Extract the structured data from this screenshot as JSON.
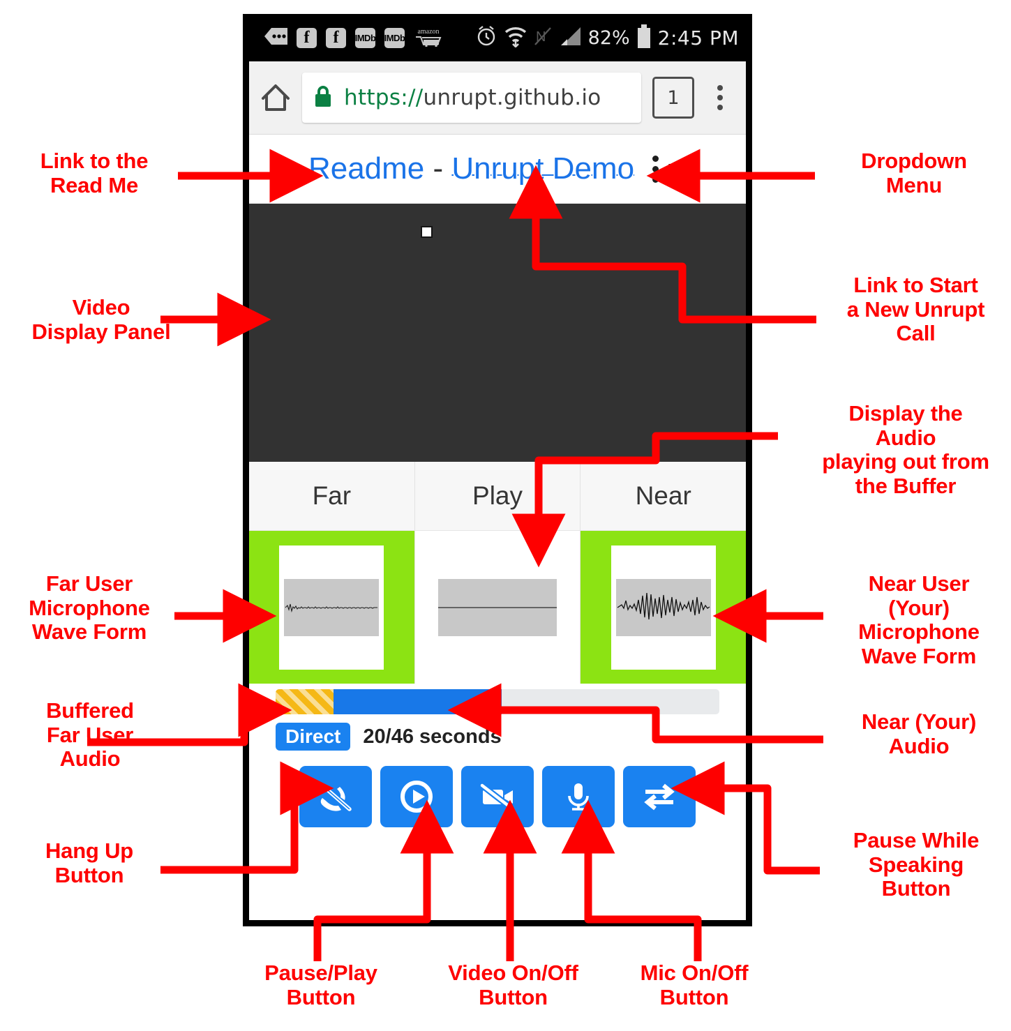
{
  "colors": {
    "annotation": "#fe0000",
    "link": "#1a73e8",
    "button_blue": "#1a82f0",
    "active_green": "#8ce313",
    "buffer_orange": "#f5b816",
    "video_panel": "#323232"
  },
  "status_bar": {
    "icons": [
      "message-icon",
      "facebook-icon",
      "facebook-icon",
      "imdb-icon",
      "imdb-icon",
      "amazon-cart-icon",
      "alarm-icon",
      "wifi-icon",
      "nfc-off-icon",
      "signal-icon"
    ],
    "imdb_label": "IMDb",
    "facebook_label": "f",
    "amazon_label": "amazon",
    "battery_percent": "82%",
    "clock": "2:45 PM"
  },
  "browser": {
    "home_icon": "home-icon",
    "lock_icon": "lock-icon",
    "url_scheme": "https://",
    "url_host": "unrupt.github.io",
    "tab_count": "1",
    "menu_icon": "kebab-menu-icon"
  },
  "page_header": {
    "readme_link": "Readme",
    "separator": " - ",
    "demo_link": "Unrupt Demo",
    "kebab_icon": "kebab-menu-icon",
    "caret_icon": "chevron-down-icon"
  },
  "cards": [
    {
      "title": "Far",
      "active": true,
      "waveform": "far-waveform"
    },
    {
      "title": "Play",
      "active": false,
      "waveform": "play-waveform"
    },
    {
      "title": "Near",
      "active": true,
      "waveform": "near-waveform"
    }
  ],
  "playback": {
    "buffer_percent": 13,
    "played_percent": 38,
    "badge": "Direct",
    "time": "20/46 seconds"
  },
  "controls": [
    {
      "name": "hang-up-button",
      "icon": "phone-slash-icon"
    },
    {
      "name": "pause-play-button",
      "icon": "play-circle-icon"
    },
    {
      "name": "video-toggle-button",
      "icon": "video-slash-icon"
    },
    {
      "name": "mic-toggle-button",
      "icon": "microphone-icon"
    },
    {
      "name": "pause-while-speaking-button",
      "icon": "exchange-arrows-icon"
    }
  ],
  "annotations": {
    "readme": "Link to the\nRead Me",
    "video_panel": "Video\nDisplay Panel",
    "far_wave": "Far User\nMicrophone\nWave Form",
    "buffered_far_audio": "Buffered\nFar User\nAudio",
    "hang_up": "Hang Up\nButton",
    "dropdown_menu": "Dropdown\nMenu",
    "new_call": "Link to Start\na New Unrupt\nCall",
    "buffer_display": "Display the\nAudio\nplaying out from\nthe Buffer",
    "near_wave": "Near User\n(Your)\nMicrophone\nWave Form",
    "near_audio": "Near (Your)\nAudio",
    "pause_while_speaking": "Pause While\nSpeaking\nButton",
    "pause_play": "Pause/Play\nButton",
    "video_onoff": "Video On/Off\nButton",
    "mic_onoff": "Mic On/Off\nButton"
  }
}
